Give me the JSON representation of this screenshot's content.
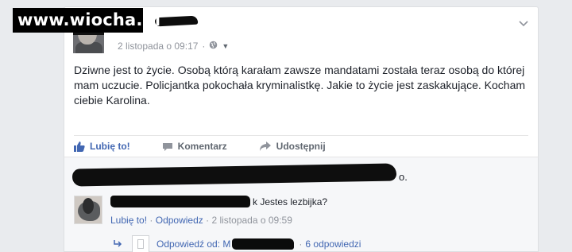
{
  "watermark": {
    "text": "www.wiocha.pl"
  },
  "post": {
    "timestamp": "2 listopada o 09:17",
    "separator": "·",
    "privacy_icon": "globe-icon",
    "text": "Dziwne jest to życie. Osobą którą karałam zawsze mandatami została teraz osobą do której mam uczucie. Policjantka pokochała kryminalistkę. Jakie to życie jest zaskakujące. Kocham ciebie Karolina.",
    "actions": {
      "like": "Lubię to!",
      "comment": "Komentarz",
      "share": "Udostępnij"
    }
  },
  "comments": {
    "trailing_dot": "o.",
    "comment": {
      "name_suffix": "k",
      "text": "Jestes lezbijka?",
      "like_label": "Lubię to!",
      "separator": "·",
      "reply_label": "Odpowiedz",
      "timestamp": "2 listopada o 09:59"
    },
    "reply_summary": {
      "prefix": "Odpowiedź od: M",
      "separator": "·",
      "count": "6 odpowiedzi"
    }
  },
  "colors": {
    "accent": "#4267b2",
    "text": "#1d2129",
    "muted": "#90949c",
    "background": "#e9ebee"
  }
}
